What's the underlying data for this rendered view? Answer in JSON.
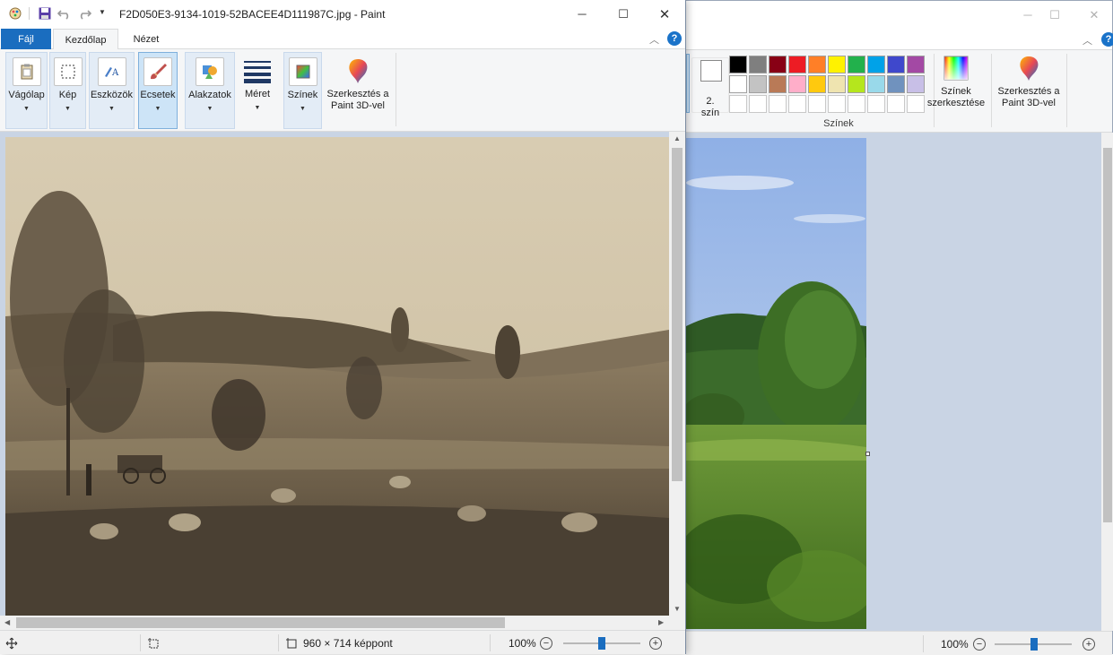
{
  "front": {
    "title": "F2D050E3-9134-1019-52BACEE4D111987C.jpg - Paint",
    "tabs": {
      "file": "Fájl",
      "home": "Kezdőlap",
      "view": "Nézet"
    },
    "ribbon": {
      "clipboard": "Vágólap",
      "image": "Kép",
      "tools": "Eszközök",
      "brushes": "Ecsetek",
      "shapes": "Alakzatok",
      "size": "Méret",
      "colors": "Színek",
      "paint3d_line1": "Szerkesztés a",
      "paint3d_line2": "Paint 3D-vel"
    },
    "status": {
      "dimensions": "960 × 714 képpont",
      "zoom": "100%"
    },
    "help": "?"
  },
  "back": {
    "color2_line1": "2.",
    "color2_line2": "szín",
    "edit_colors_line1": "Színek",
    "edit_colors_line2": "szerkesztése",
    "colors_group": "Színek",
    "paint3d_line1": "Szerkesztés a",
    "paint3d_line2": "Paint 3D-vel",
    "status": {
      "zoom": "100%"
    },
    "help": "?",
    "palette_row1": [
      "#000000",
      "#7f7f7f",
      "#880015",
      "#ed1c24",
      "#ff7f27",
      "#fff200",
      "#22b14c",
      "#00a2e8",
      "#3f48cc",
      "#a349a4"
    ],
    "palette_row2": [
      "#ffffff",
      "#c3c3c3",
      "#b97a57",
      "#ffaec9",
      "#ffc90e",
      "#efe4b0",
      "#b5e61d",
      "#99d9ea",
      "#7092be",
      "#c8bfe7"
    ]
  },
  "glyphs": {
    "minimize": "─",
    "maximize": "☐",
    "close": "✕",
    "collapse": "︿",
    "dropdown": "▼",
    "zoom_out": "−",
    "zoom_in": "+"
  }
}
